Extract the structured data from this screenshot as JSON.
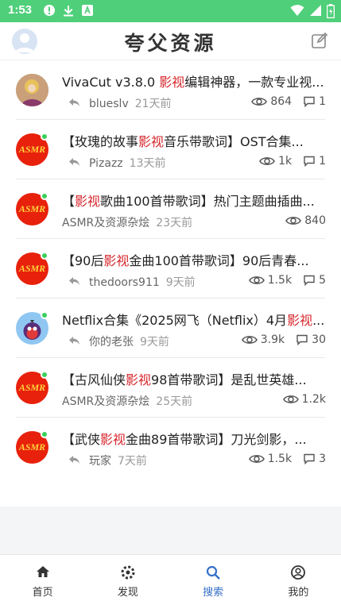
{
  "status": {
    "time": "1:53"
  },
  "app": {
    "title": "夸父资源"
  },
  "posts": [
    {
      "title_pre": "VivaCut v3.8.0 ",
      "title_hl": "影视",
      "title_post": "编辑神器，一款专业视...",
      "user": "blueslv",
      "time": "21天前",
      "views": "864",
      "comments": "1",
      "avatar": "photo",
      "reply_icon": true
    },
    {
      "title_pre": "【玫瑰的故事",
      "title_hl": "影视",
      "title_post": "音乐带歌词】OST合集...",
      "user": "Pizazz",
      "time": "13天前",
      "views": "1k",
      "comments": "1",
      "avatar": "asmr",
      "reply_icon": true
    },
    {
      "title_pre": "【",
      "title_hl": "影视",
      "title_post": "歌曲100首带歌词】热门主题曲插曲...",
      "user": "ASMR及资源杂烩",
      "time": "23天前",
      "views": "840",
      "comments": "",
      "avatar": "asmr",
      "reply_icon": false
    },
    {
      "title_pre": "【90后",
      "title_hl": "影视",
      "title_post": "金曲100首带歌词】90后青春...",
      "user": "thedoors911",
      "time": "9天前",
      "views": "1.5k",
      "comments": "5",
      "avatar": "asmr",
      "reply_icon": true
    },
    {
      "title_pre": "Netflix合集《2025网飞（Netflix）4月",
      "title_hl": "影视",
      "title_post": "...",
      "user": "你的老张",
      "time": "9天前",
      "views": "3.9k",
      "comments": "30",
      "avatar": "bird",
      "reply_icon": true
    },
    {
      "title_pre": "【古风仙侠",
      "title_hl": "影视",
      "title_post": "98首带歌词】是乱世英雄...",
      "user": "ASMR及资源杂烩",
      "time": "25天前",
      "views": "1.2k",
      "comments": "",
      "avatar": "asmr",
      "reply_icon": false
    },
    {
      "title_pre": "【武侠",
      "title_hl": "影视",
      "title_post": "金曲89首带歌词】刀光剑影，...",
      "user": "玩家",
      "time": "7天前",
      "views": "1.5k",
      "comments": "3",
      "avatar": "asmr",
      "reply_icon": true
    }
  ],
  "avatar_text": "ASMR",
  "tabs": [
    {
      "label": "首页",
      "icon": "home-icon",
      "active": false
    },
    {
      "label": "发现",
      "icon": "discover-icon",
      "active": false
    },
    {
      "label": "搜索",
      "icon": "search-icon",
      "active": true
    },
    {
      "label": "我的",
      "icon": "profile-icon",
      "active": false
    }
  ],
  "colors": {
    "status_bar": "#4fcf7a",
    "highlight": "#d6262c",
    "active_tab": "#3570c8",
    "asmr_bg": "#e8210c"
  }
}
